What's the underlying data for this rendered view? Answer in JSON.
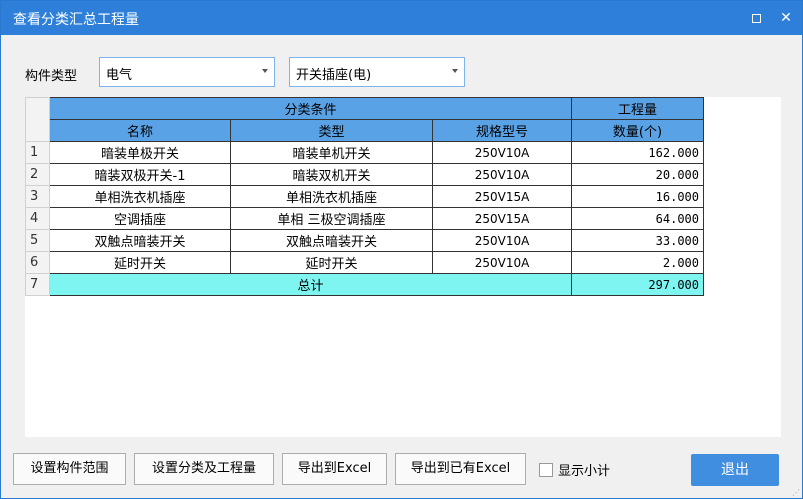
{
  "window": {
    "title": "查看分类汇总工程量"
  },
  "filters": {
    "type_label": "构件类型",
    "category": "电气",
    "subcategory": "开关插座(电)"
  },
  "table": {
    "group_header": "分类条件",
    "quantity_header": "工程量",
    "columns": [
      "名称",
      "类型",
      "规格型号",
      "数量(个)"
    ],
    "rows": [
      {
        "no": "1",
        "name": "暗装单极开关",
        "type": "暗装单机开关",
        "spec": "250V10A",
        "qty": "162.000"
      },
      {
        "no": "2",
        "name": "暗装双极开关-1",
        "type": "暗装双机开关",
        "spec": "250V10A",
        "qty": "20.000"
      },
      {
        "no": "3",
        "name": "单相洗衣机插座",
        "type": "单相洗衣机插座",
        "spec": "250V15A",
        "qty": "16.000"
      },
      {
        "no": "4",
        "name": "空调插座",
        "type": "单相 三极空调插座",
        "spec": "250V15A",
        "qty": "64.000"
      },
      {
        "no": "5",
        "name": "双触点暗装开关",
        "type": "双触点暗装开关",
        "spec": "250V10A",
        "qty": "33.000"
      },
      {
        "no": "6",
        "name": "延时开关",
        "type": "延时开关",
        "spec": "250V10A",
        "qty": "2.000"
      }
    ],
    "total": {
      "no": "7",
      "label": "总计",
      "qty": "297.000"
    }
  },
  "buttons": {
    "set_range": "设置构件范围",
    "set_class": "设置分类及工程量",
    "export_excel": "导出到Excel",
    "export_existing": "导出到已有Excel",
    "show_subtotal": "显示小计",
    "exit": "退出"
  },
  "colors": {
    "titlebar": "#2e7fd9",
    "header": "#5aa2e6",
    "total": "#7ff5f2",
    "exit": "#3f8ee0"
  }
}
